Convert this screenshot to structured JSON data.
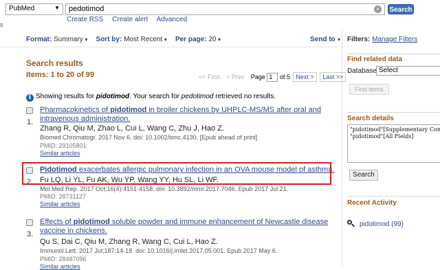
{
  "topbar": {
    "database": "PubMed",
    "query": "pedotimod",
    "clear_glyph": "×",
    "search_label": "Search",
    "links": [
      "Create RSS",
      "Create alert",
      "Advanced"
    ],
    "left_fragment": "s"
  },
  "format_bar": {
    "format_label": "Format:",
    "format_value": "Summary",
    "sort_label": "Sort by:",
    "sort_value": "Most Recent",
    "perpage_label": "Per page:",
    "perpage_value": "20",
    "send_to": "Send to"
  },
  "results_header": {
    "heading": "Search results",
    "items": "Items: 1 to 20 of 99"
  },
  "pager": {
    "first": "<< First",
    "prev": "< Prev",
    "page_label": "Page",
    "page_value": "1",
    "of": "of 5",
    "next": "Next >",
    "last": "Last >>"
  },
  "notice": {
    "info_glyph": "i",
    "prefix": "Showing results for ",
    "term": "pidotimod",
    "middle": ". Your search for ",
    "orig": "pedotimod",
    "suffix": " retrieved no results."
  },
  "results": [
    {
      "number": "1.",
      "title_before": "Pharmacokinetics of ",
      "title_bold": "pidotimod",
      "title_after": " in broiler chickens by UHPLC-MS/MS after oral and intravenous administration.",
      "authors": "Zhang R, Qiu M, Zhao L, Cui L, Wang C, Zhu J, Hao Z.",
      "citation": "Biomed Chromatogr. 2017 Nov 6. doi: 10.1002/bmc.4130. [Epub ahead of print]",
      "pmid": "PMID: 29105801",
      "similar": "Similar articles"
    },
    {
      "number": "2.",
      "title_before": "",
      "title_bold": "Pidotimod",
      "title_after": " exacerbates allergic pulmonary infection in an OVA mouse model of asthma.",
      "authors": "Fu LQ, Li YL, Fu AK, Wu YP, Wang YY, Hu SL, Li WF.",
      "citation": "Mol Med Rep. 2017 Oct;16(4):4151-4158. doi: 10.3892/mmr.2017.7046. Epub 2017 Jul 21.",
      "pmid": "PMID: 28731127",
      "similar": "Similar articles"
    },
    {
      "number": "3.",
      "title_before": "Effects of ",
      "title_bold": "pidotimod",
      "title_after": " soluble powder and immune enhancement of Newcastle disease vaccine in chickens.",
      "authors": "Qu S, Dai C, Qiu M, Zhang R, Wang C, Cui L, Hao Z.",
      "citation": "Immunol Lett. 2017 Jul;187:14-18. doi: 10.1016/j.imlet.2017.05.001. Epub 2017 May 6.",
      "pmid": "PMID: 28487096",
      "similar": "Similar articles"
    }
  ],
  "sidebar": {
    "filters_label": "Filters:",
    "manage_filters": "Manage Filters",
    "related_title": "Find related data",
    "database_label": "Database:",
    "database_value": "Select",
    "find_items": "Find items",
    "details_title": "Search details",
    "details_lines": [
      "\"pidotimod\"[Supplementary Concept] OR",
      "\"pidotimod\"[All Fields]"
    ],
    "details_search": "Search",
    "recent_title": "Recent Activity",
    "recent_item": "pidotimod (99)"
  },
  "colors": {
    "accent": "#3b6fb6",
    "link": "#2f4a8a",
    "heading": "#9b5a1a",
    "highlight": "#d21f1f"
  }
}
